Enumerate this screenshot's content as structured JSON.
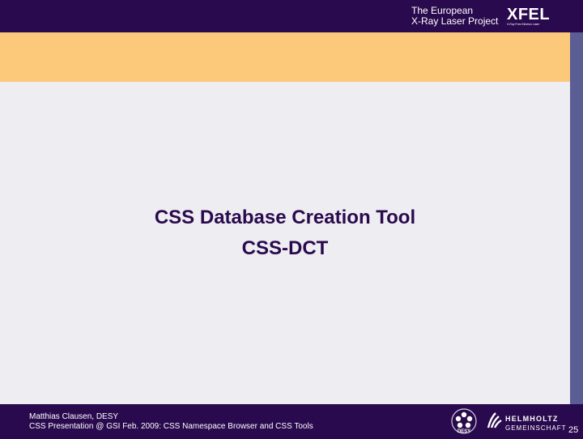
{
  "header": {
    "tagline_line1": "The European",
    "tagline_line2": "X-Ray Laser Project",
    "logo_text": "XFEL",
    "logo_subtext": "X-Ray Free-Electron Laser"
  },
  "slide": {
    "title_line1": "CSS Database Creation Tool",
    "title_line2": "CSS-DCT"
  },
  "footer": {
    "author": "Matthias Clausen, DESY",
    "presentation": "CSS Presentation @ GSI Feb. 2009: CSS Namespace Browser and CSS Tools",
    "desy_logo_text": "DESY",
    "helmholtz_line1": "HELMHOLTZ",
    "helmholtz_line2": "GEMEINSCHAFT",
    "page_number": "25"
  },
  "colors": {
    "header_bg": "#2a0a4e",
    "accent_orange": "#fcc97a",
    "content_bg": "#eeedf1",
    "side_bar": "#5b5e94",
    "title_text": "#2a0a4e"
  }
}
